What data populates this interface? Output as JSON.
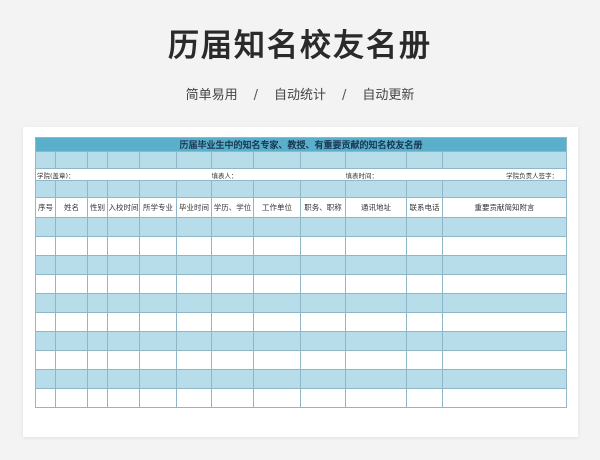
{
  "page": {
    "title": "历届知名校友名册",
    "tags": [
      "简单易用",
      "自动统计",
      "自动更新"
    ],
    "separator": "/"
  },
  "sheet": {
    "title": "历届毕业生中的知名专家、教授、有重要贡献的知名校友名册",
    "info": {
      "school": "学院(盖章)：",
      "filler": "填表人：",
      "date": "填表时间：",
      "signature": "学院负责人签字："
    },
    "headers": [
      "序号",
      "姓名",
      "性别",
      "入校时间",
      "所学专业",
      "毕业时间",
      "学历、学位",
      "工作单位",
      "职务、职称",
      "通讯地址",
      "联系电话",
      "重要贡献简知附言"
    ],
    "data_row_count": 10
  },
  "colors": {
    "title_bar": "#5ab0cb",
    "band_blue": "#b6dde9",
    "grid_line": "#8fb7c8"
  }
}
